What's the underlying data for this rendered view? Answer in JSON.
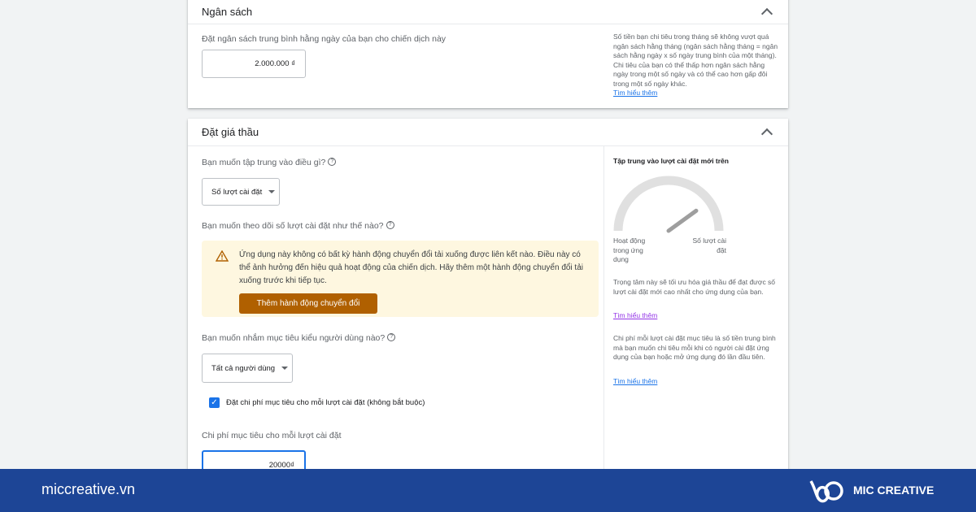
{
  "budget": {
    "title": "Ngân sách",
    "label": "Đặt ngân sách trung bình hằng ngày của bạn cho chiến dịch này",
    "value": "2.000.000 ₫",
    "help": "Số tiền bạn chi tiêu trong tháng sẽ không vượt quá ngân sách hằng tháng (ngân sách hằng tháng = ngân sách hằng ngày x số ngày trung bình của một tháng). Chi tiêu của bạn có thể thấp hơn ngân sách hằng ngày trong một số ngày và có thể cao hơn gấp đôi trong một số ngày khác.",
    "learn_more": "Tìm hiểu thêm"
  },
  "bidding": {
    "title": "Đặt giá thầu",
    "focus_q": "Bạn muốn tập trung vào điều gì?",
    "focus_value": "Số lượt cài đặt",
    "track_q": "Bạn muốn theo dõi số lượt cài đặt như thế nào?",
    "warning": "Ứng dụng này không có bất kỳ hành động chuyển đổi tải xuống được liên kết nào. Điều này có thể ảnh hưởng đến hiệu quả hoạt động của chiến dịch. Hãy thêm một hành động chuyển đổi tải xuống trước khi tiếp tục.",
    "warning_button": "Thêm hành động chuyển đổi",
    "target_q": "Bạn muốn nhắm mục tiêu kiểu người dùng nào?",
    "target_value": "Tất cả người dùng",
    "checkbox_label": "Đặt chi phí mục tiêu cho mỗi lượt cài đặt (không bắt buộc)",
    "checkbox_checked": true,
    "cpi_label": "Chi phí mục tiêu cho mỗi lượt cài đặt",
    "cpi_value": "20000₫",
    "side": {
      "title": "Tập trung vào lượt cài đặt mới trên",
      "gauge_left": "Hoạt động trong ứng dụng",
      "gauge_right": "Số lượt cài đặt",
      "gauge_level": 0.8,
      "desc1": "Trọng tâm này sẽ tối ưu hóa giá thầu để đạt được số lượt cài đặt mới cao nhất cho ứng dụng của bạn.",
      "learn_more1": "Tìm hiểu thêm",
      "desc2": "Chi phí mỗi lượt cài đặt mục tiêu là số tiền trung bình mà bạn muốn chi tiêu mỗi khi có người cài đặt ứng dụng của bạn hoặc mở ứng dụng đó lần đầu tiên.",
      "learn_more2": "Tìm hiểu thêm"
    }
  },
  "footer": {
    "site": "miccreative.vn",
    "brand": "MIC CREATIVE"
  },
  "colors": {
    "accent": "#1a73e8",
    "warning_bg": "#fef7e0",
    "warning_button": "#b06000",
    "footer": "#1d4596"
  }
}
